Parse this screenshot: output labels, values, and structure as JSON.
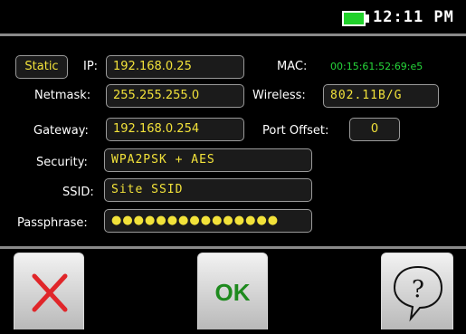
{
  "status": {
    "time": "12:11 PM"
  },
  "network": {
    "mode_button": "Static",
    "ip_label": "IP:",
    "ip_value": "192.168.0.25",
    "mac_label": "MAC:",
    "mac_value": "00:15:61:52:69:e5",
    "netmask_label": "Netmask:",
    "netmask_value": "255.255.255.0",
    "wireless_label": "Wireless:",
    "wireless_value": "802.11B/G",
    "gateway_label": "Gateway:",
    "gateway_value": "192.168.0.254",
    "port_offset_label": "Port Offset:",
    "port_offset_value": "0",
    "security_label": "Security:",
    "security_value": "WPA2PSK + AES",
    "ssid_label": "SSID:",
    "ssid_value": "Site SSID",
    "passphrase_label": "Passphrase:",
    "passphrase_value": "●●●●●●●●●●●●●●●"
  },
  "actions": {
    "ok_label": "OK"
  },
  "colors": {
    "accent_text": "#f2e23a",
    "mac_text": "#26d63a",
    "battery": "#21d12b",
    "cancel": "#e0262a",
    "ok": "#1e8a1e"
  },
  "icons": {
    "battery": "battery-icon",
    "cancel": "close-icon",
    "help": "help-icon"
  }
}
